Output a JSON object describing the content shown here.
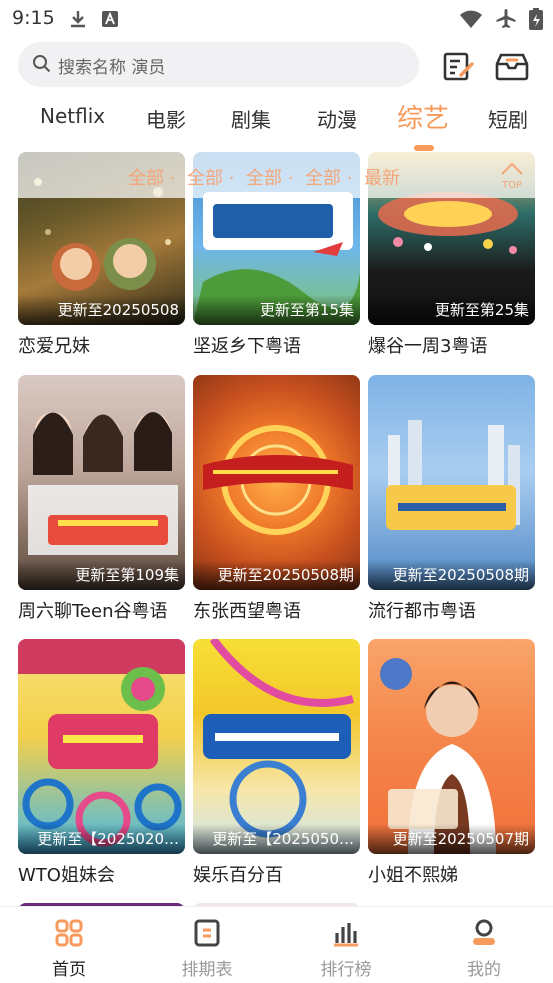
{
  "status": {
    "time": "9:15"
  },
  "search": {
    "placeholder": "搜索名称 演员"
  },
  "tabs": [
    {
      "label": "Netflix"
    },
    {
      "label": "电影"
    },
    {
      "label": "剧集"
    },
    {
      "label": "动漫"
    },
    {
      "label": "综艺"
    },
    {
      "label": "短剧"
    }
  ],
  "filter": {
    "items": [
      "全部",
      "全部",
      "全部",
      "全部",
      "最新"
    ],
    "top_label": "TOP"
  },
  "cards": [
    {
      "badge": "更新至20250508",
      "title": "恋爱兄妹"
    },
    {
      "badge": "更新至第15集",
      "title": "坚返乡下粤语"
    },
    {
      "badge": "更新至第25集",
      "title": "爆谷一周3粤语"
    },
    {
      "badge": "更新至第109集",
      "title": "周六聊Teen谷粤语"
    },
    {
      "badge": "更新至20250508期",
      "title": "东张西望粤语"
    },
    {
      "badge": "更新至20250508期",
      "title": "流行都市粤语"
    },
    {
      "badge": "更新至【2025020…",
      "title": "WTO姐妹会"
    },
    {
      "badge": "更新至【2025050…",
      "title": "娱乐百分百"
    },
    {
      "badge": "更新至20250507期",
      "title": "小姐不熙娣"
    }
  ],
  "nav": [
    {
      "label": "首页"
    },
    {
      "label": "排期表"
    },
    {
      "label": "排行榜"
    },
    {
      "label": "我的"
    }
  ],
  "colors": {
    "accent": "#f79b5d",
    "filter_text": "#f4a67a",
    "search_bg": "#f1f1f3"
  }
}
